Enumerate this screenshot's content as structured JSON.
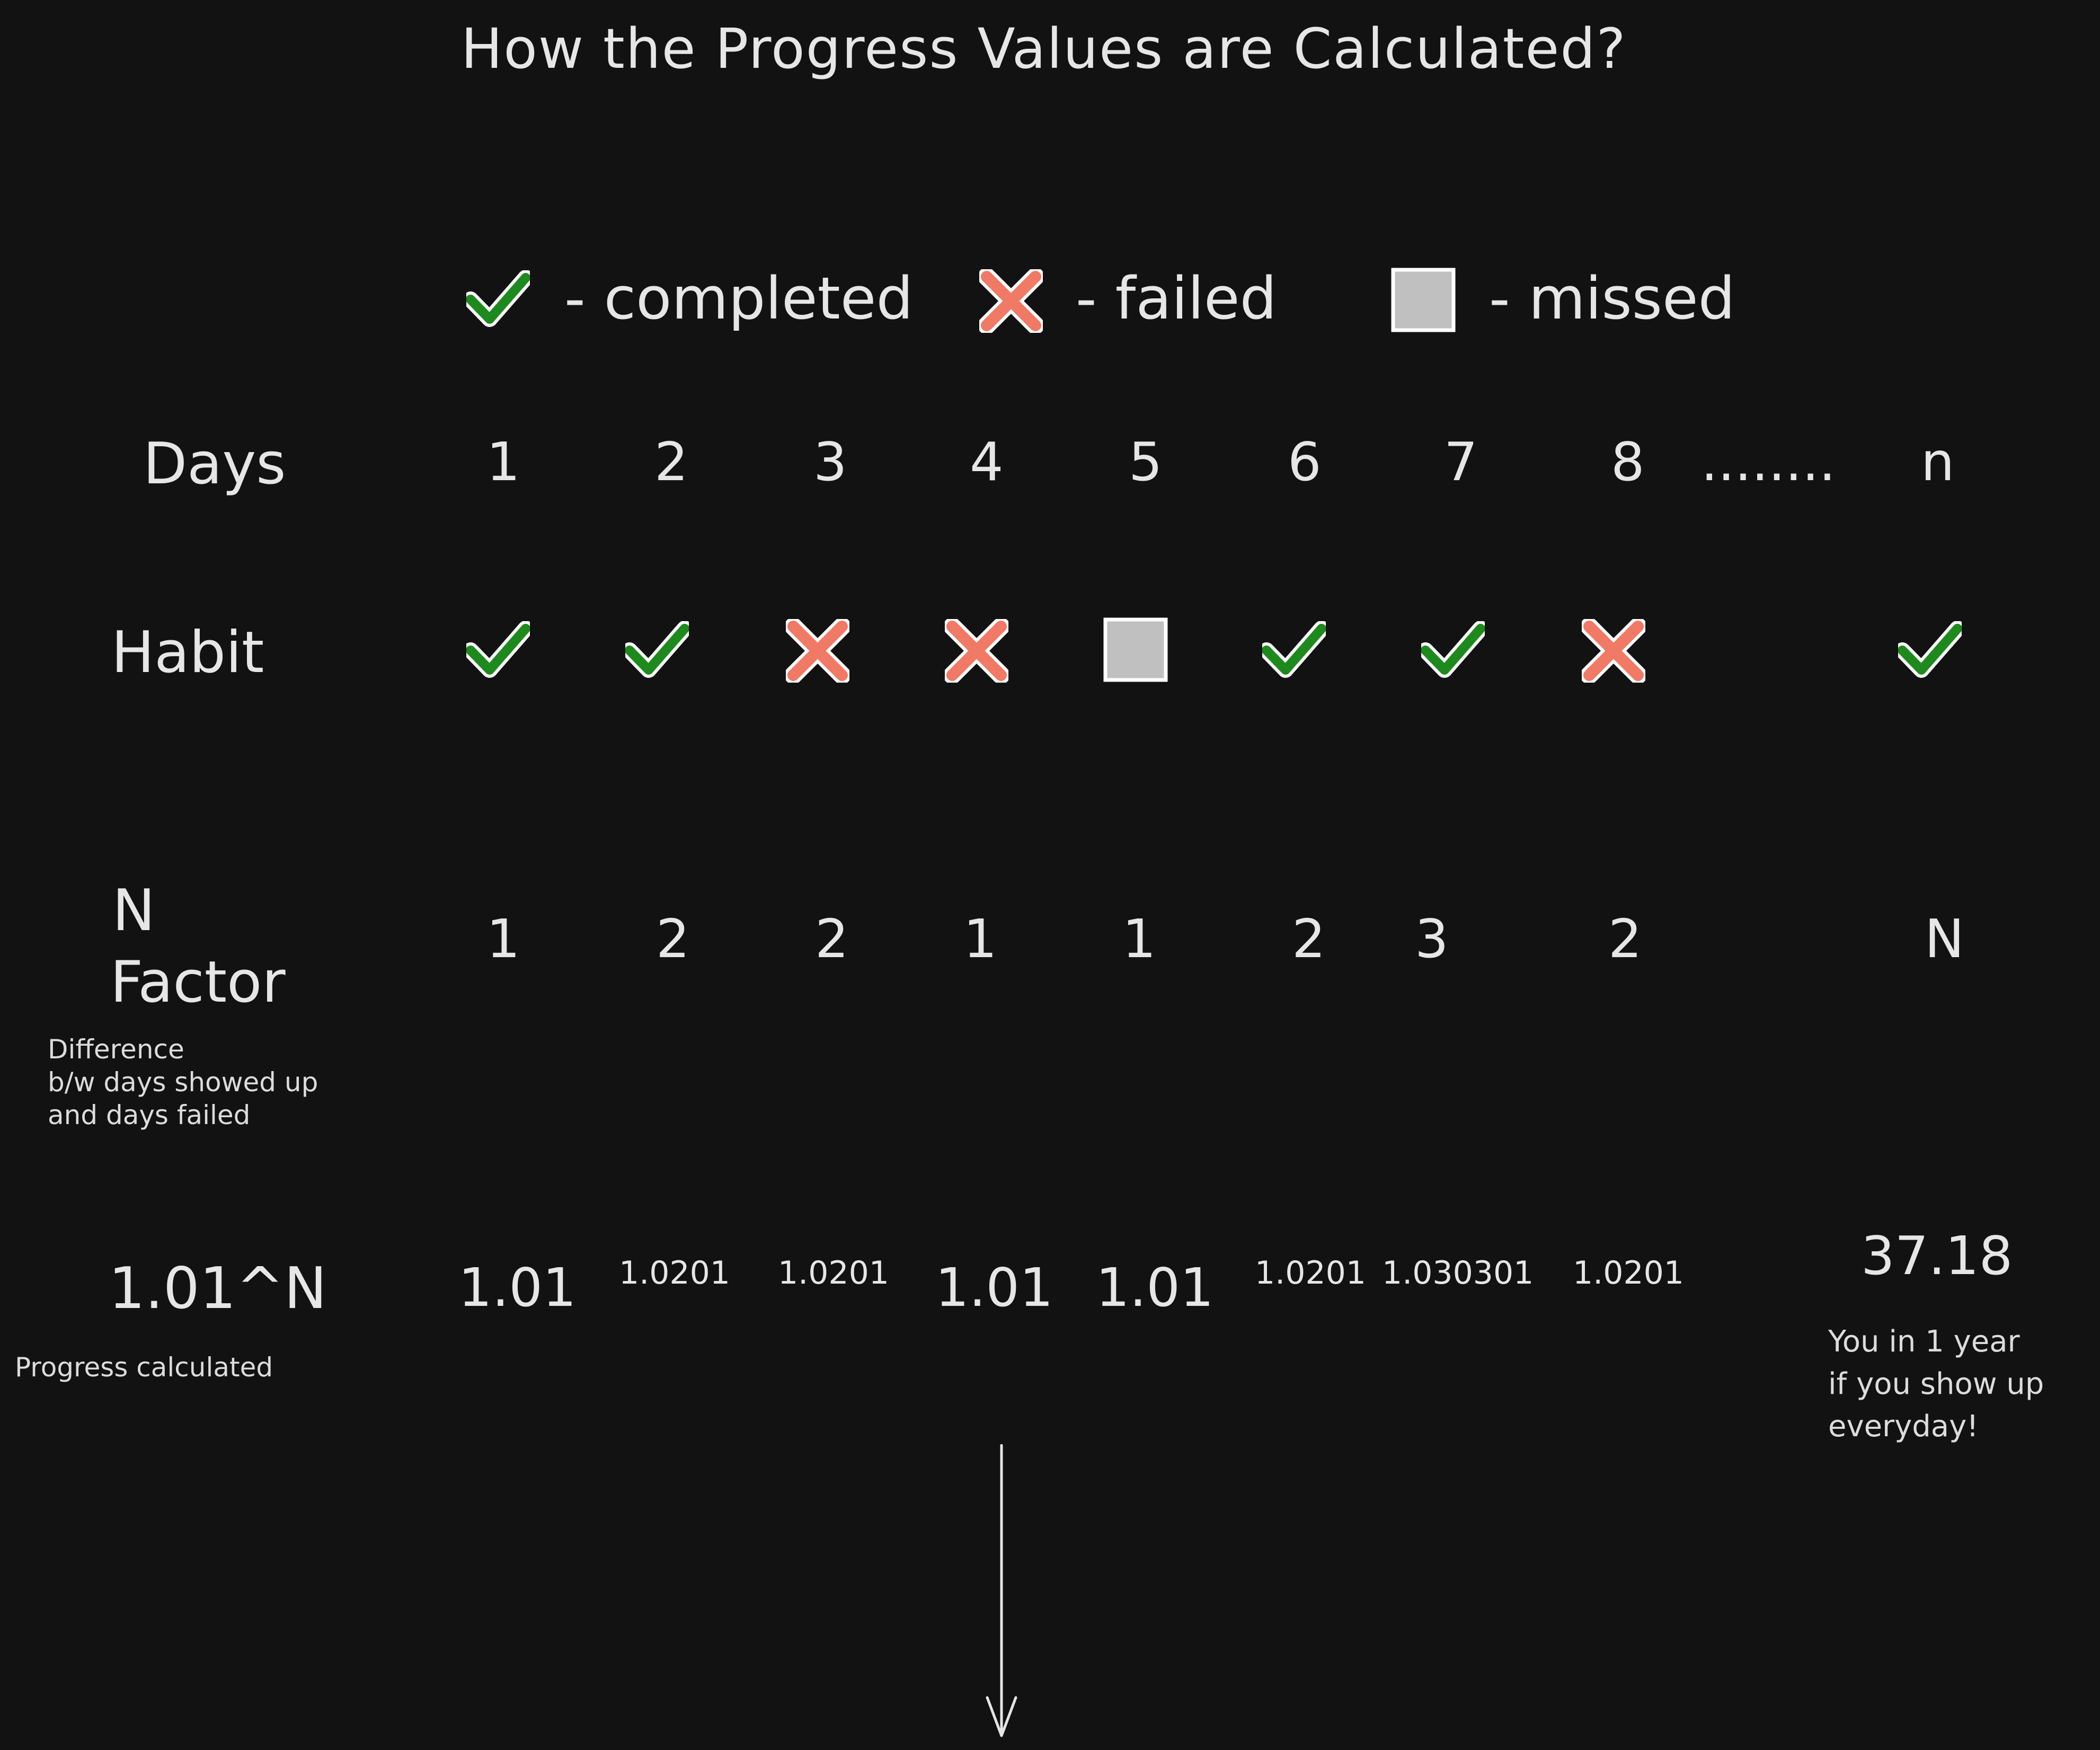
{
  "title": "How the Progress Values are Calculated?",
  "legend": {
    "completed": "- completed",
    "failed": "- failed",
    "missed": "- missed"
  },
  "labels": {
    "days": "Days",
    "habit": "Habit",
    "n_factor_line1": "N",
    "n_factor_line2": "Factor",
    "n_factor_note": [
      "Difference",
      "b/w days showed up",
      "and days failed"
    ],
    "formula": "1.01^N",
    "formula_note": "Progress calculated"
  },
  "days": [
    "1",
    "2",
    "3",
    "4",
    "5",
    "6",
    "7",
    "8",
    "........",
    "n"
  ],
  "habit": [
    "completed",
    "completed",
    "failed",
    "failed",
    "missed",
    "completed",
    "completed",
    "failed",
    "",
    "completed"
  ],
  "n_factor": [
    "1",
    "2",
    "2",
    "1",
    "1",
    "2",
    "3",
    "2",
    "",
    "N"
  ],
  "progress": [
    "1.01",
    "1.0201",
    "1.0201",
    "1.01",
    "1.01",
    "1.0201",
    "1.030301",
    "1.0201",
    "",
    "37.18"
  ],
  "year_note": [
    "You in 1 year",
    "if you show up",
    "everyday!"
  ],
  "colors": {
    "background": "#121212",
    "text": "#e6e6e6",
    "check": "#1e8a1e",
    "cross": "#f07a65",
    "missed": "#c0c0c0"
  }
}
